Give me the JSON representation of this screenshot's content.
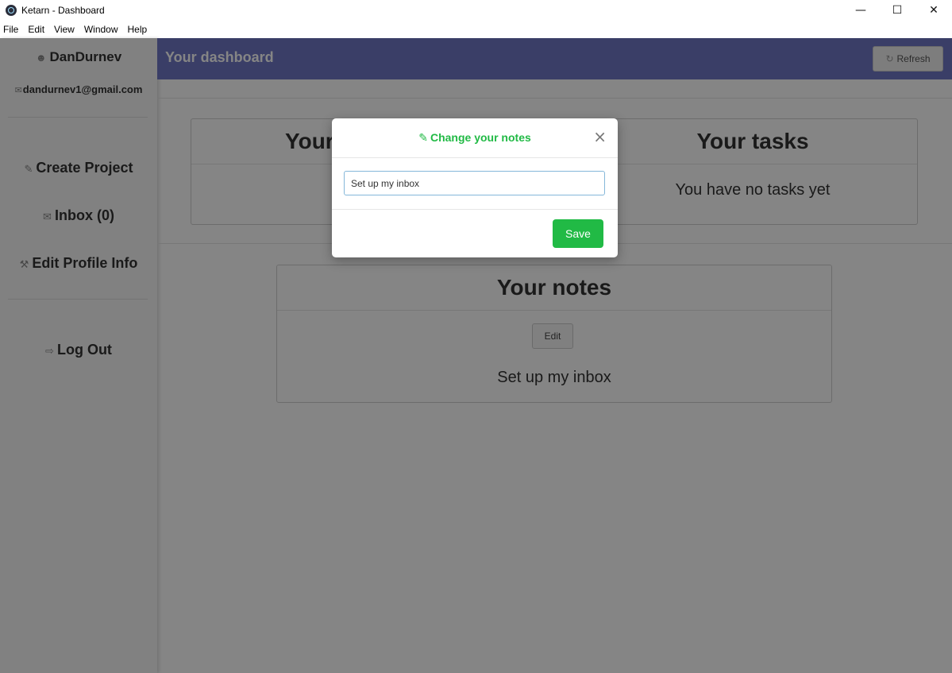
{
  "window": {
    "title": "Ketarn - Dashboard",
    "minimize": "—",
    "maximize": "☐",
    "close": "✕"
  },
  "menu": [
    "File",
    "Edit",
    "View",
    "Window",
    "Help"
  ],
  "sidebar": {
    "username": "DanDurnev",
    "email": "dandurnev1@gmail.com",
    "links": {
      "create_project": "Create Project",
      "inbox": "Inbox (0)",
      "edit_profile": "Edit Profile Info",
      "logout": "Log Out"
    }
  },
  "header": {
    "title": "Your dashboard",
    "refresh_label": "Refresh"
  },
  "cards": {
    "projects": {
      "title_visible": "Your"
    },
    "tasks": {
      "title": "Your tasks",
      "empty_text": "You have no tasks yet"
    },
    "notes": {
      "title": "Your notes",
      "edit_label": "Edit",
      "text": "Set up my inbox"
    }
  },
  "modal": {
    "title": "Change your notes",
    "input_value": "Set up my inbox",
    "save_label": "Save",
    "close_glyph": "×"
  },
  "colors": {
    "accent_green": "#21ba45",
    "topbar": "#6f78c6",
    "overlay": "rgba(0,0,0,0.48)"
  },
  "icons": {
    "user": "☻",
    "mail": "✉",
    "pencil": "✎",
    "wrench": "⚒",
    "logout": "⇨",
    "refresh": "↻"
  }
}
